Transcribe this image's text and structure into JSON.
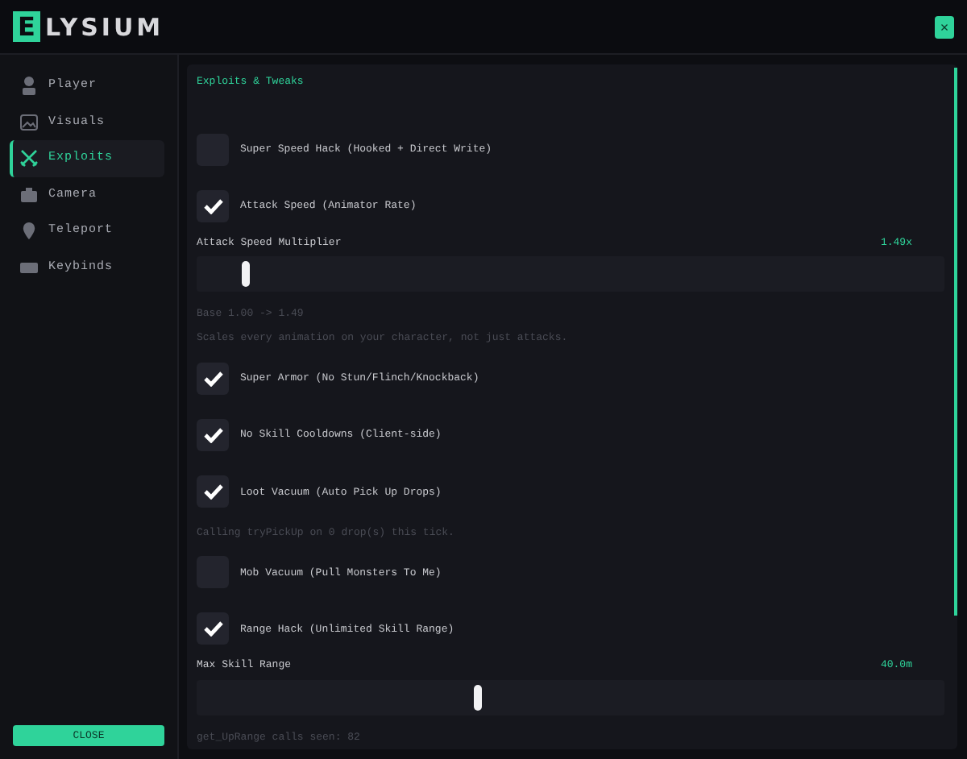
{
  "header": {
    "logo_letter": "E",
    "name": "LYSIUM",
    "close_glyph": "×"
  },
  "sidebar": {
    "items": [
      {
        "label": "Player",
        "selected": false
      },
      {
        "label": "Visuals",
        "selected": false
      },
      {
        "label": "Exploits",
        "selected": true
      },
      {
        "label": "Camera",
        "selected": false
      },
      {
        "label": "Teleport",
        "selected": false
      },
      {
        "label": "Keybinds",
        "selected": false
      }
    ],
    "close_button": "CLOSE"
  },
  "panel": {
    "title": "Exploits & Tweaks",
    "items": [
      {
        "kind": "toggle",
        "label": "Super Speed Hack (Hooked + Direct Write)",
        "checked": false
      },
      {
        "kind": "toggle",
        "label": "Attack Speed (Animator Rate)",
        "checked": true
      },
      {
        "kind": "slider",
        "label": "Attack Speed Multiplier",
        "reading": "1.49x",
        "level": 0.06
      },
      {
        "kind": "note",
        "text": "Base 1.00  ->  1.49"
      },
      {
        "kind": "note",
        "text": "Scales every animation on your character, not just attacks."
      },
      {
        "kind": "toggle",
        "label": "Super Armor (No Stun/Flinch/Knockback)",
        "checked": true
      },
      {
        "kind": "toggle",
        "label": "No Skill Cooldowns (Client-side)",
        "checked": true
      },
      {
        "kind": "toggle",
        "label": "Loot Vacuum (Auto Pick Up Drops)",
        "checked": true
      },
      {
        "kind": "note",
        "text": "Calling tryPickUp on 0 drop(s) this tick."
      },
      {
        "kind": "toggle",
        "label": "Mob Vacuum (Pull Monsters To Me)",
        "checked": false
      },
      {
        "kind": "toggle",
        "label": "Range Hack (Unlimited Skill Range)",
        "checked": true
      },
      {
        "kind": "slider",
        "label": "Max Skill Range",
        "reading": "40.0m",
        "level": 0.37
      },
      {
        "kind": "note",
        "text": "get_UpRange calls seen: 82"
      }
    ]
  }
}
